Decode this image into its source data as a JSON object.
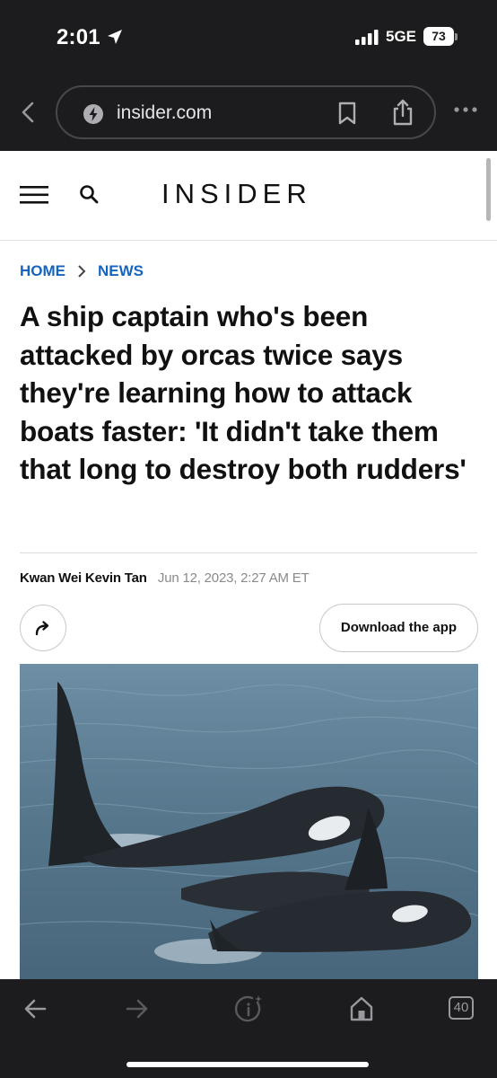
{
  "status_bar": {
    "time": "2:01",
    "network": "5GE",
    "battery": "73"
  },
  "browser": {
    "url": "insider.com",
    "tab_count": "40"
  },
  "site": {
    "logo": "INSIDER"
  },
  "article": {
    "breadcrumb": [
      "HOME",
      "NEWS"
    ],
    "headline": "A ship captain who's been attacked by orcas twice says they're learning how to attack boats faster: 'It didn't take them that long to destroy both rudders'",
    "author": "Kwan Wei Kevin Tan",
    "date": "Jun 12, 2023, 2:27 AM ET",
    "download_label": "Download the app"
  },
  "icons": {
    "status": [
      "location-arrow-icon",
      "signal-bars-icon",
      "battery-icon"
    ],
    "browser_top": [
      "chevron-left-icon",
      "site-lock-icon",
      "bookmark-icon",
      "share-icon",
      "more-dots-icon"
    ],
    "header": [
      "hamburger-menu-icon",
      "search-icon"
    ],
    "article": [
      "share-arrow-icon"
    ],
    "browser_bottom": [
      "back-arrow-icon",
      "forward-arrow-icon",
      "info-sparkle-icon",
      "home-icon",
      "tabs-icon"
    ]
  },
  "colors": {
    "chrome_bg": "#1c1c1e",
    "breadcrumb_link": "#1565c0",
    "headline_text": "#111111",
    "byline_date": "#8a8a8a"
  }
}
